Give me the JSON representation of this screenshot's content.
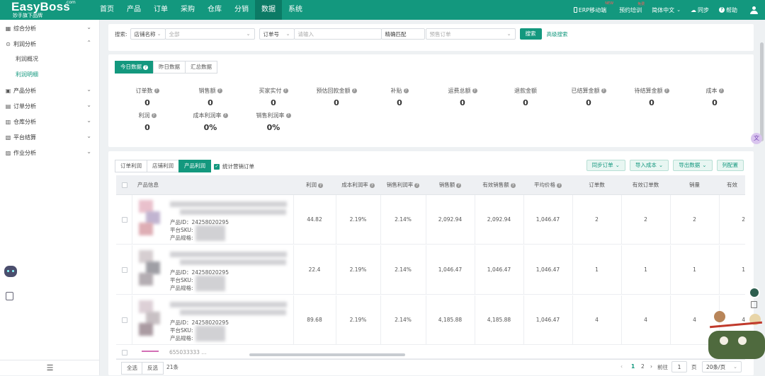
{
  "header": {
    "brand": "EasyBoss",
    "brand_suffix": ".com",
    "brand_sub": "妙手旗下品牌",
    "nav": [
      "首页",
      "产品",
      "订单",
      "采购",
      "仓库",
      "分销",
      "数据",
      "系统"
    ],
    "nav_active": "数据",
    "right": {
      "erp": "ERP移动端",
      "erp_badge": "NEW",
      "training": "预约培训",
      "training_badge": "免费",
      "lang": "简体中文",
      "sync": "同步",
      "help": "帮助"
    }
  },
  "sidebar": {
    "items": [
      {
        "label": "综合分析"
      },
      {
        "label": "利润分析",
        "children": [
          "利润概况",
          "利润明细"
        ]
      },
      {
        "label": "产品分析"
      },
      {
        "label": "订单分析"
      },
      {
        "label": "仓库分析"
      },
      {
        "label": "平台结算"
      },
      {
        "label": "作业分析"
      }
    ],
    "active_child": "利润明细"
  },
  "search": {
    "label": "搜索:",
    "store_select": "店铺名称",
    "store_value": "全部",
    "order_select": "订单号",
    "order_placeholder": "请输入",
    "match": "精确匹配",
    "preset_placeholder": "预售订单",
    "search_button": "搜索",
    "advanced": "高级搜索"
  },
  "stats": {
    "tabs": [
      "今日数据",
      "昨日数据",
      "汇总数据"
    ],
    "active_tab": "今日数据",
    "row1": [
      {
        "label": "订单数",
        "value": "0"
      },
      {
        "label": "销售额",
        "value": "0"
      },
      {
        "label": "买家实付",
        "value": "0"
      },
      {
        "label": "预估回款金额",
        "value": "0"
      },
      {
        "label": "补贴",
        "value": "0"
      },
      {
        "label": "运费总额",
        "value": "0"
      },
      {
        "label": "退款金额",
        "value": "0"
      },
      {
        "label": "已结算金额",
        "value": "0"
      },
      {
        "label": "待结算金额",
        "value": "0"
      },
      {
        "label": "成本",
        "value": "0"
      }
    ],
    "row2": [
      {
        "label": "利润",
        "value": "0"
      },
      {
        "label": "成本利润率",
        "value": "0%"
      },
      {
        "label": "销售利润率",
        "value": "0%"
      }
    ]
  },
  "table_section": {
    "tabs": [
      "订单利润",
      "店铺利润",
      "产品利润"
    ],
    "active_tab": "产品利润",
    "include_label": "统计营销订单",
    "actions": [
      "同步订单",
      "导入成本",
      "导出数据",
      "列配置"
    ],
    "columns": [
      "产品信息",
      "利润",
      "成本利润率",
      "销售利润率",
      "销售额",
      "有效销售额",
      "平均价格",
      "订单数",
      "有效订单数",
      "销量",
      "有效"
    ],
    "rows": [
      {
        "product_id": "产品ID：24258020295",
        "sku_label": "平台SKU:",
        "spec_label": "产品规格:",
        "cells": [
          "44.82",
          "2.19%",
          "2.14%",
          "2,092.94",
          "2,092.94",
          "1,046.47",
          "2",
          "2",
          "2",
          "2"
        ]
      },
      {
        "product_id": "产品ID：24258020295",
        "sku_label": "平台SKU:",
        "spec_label": "产品规格:",
        "cells": [
          "22.4",
          "2.19%",
          "2.14%",
          "1,046.47",
          "1,046.47",
          "1,046.47",
          "1",
          "1",
          "1",
          "1"
        ]
      },
      {
        "product_id": "产品ID：24258020295",
        "sku_label": "平台SKU:",
        "spec_label": "产品规格:",
        "cells": [
          "89.68",
          "2.19%",
          "2.14%",
          "4,185.88",
          "4,185.88",
          "1,046.47",
          "4",
          "4",
          "4",
          "4"
        ]
      }
    ],
    "partial_row_text": "655033333 ...",
    "footer": {
      "select_all": "全选",
      "invert": "反选",
      "total": "21条",
      "pages": [
        "1",
        "2"
      ],
      "goto": "前往",
      "goto_value": "1",
      "page_unit": "页",
      "page_size": "20条/页"
    }
  }
}
